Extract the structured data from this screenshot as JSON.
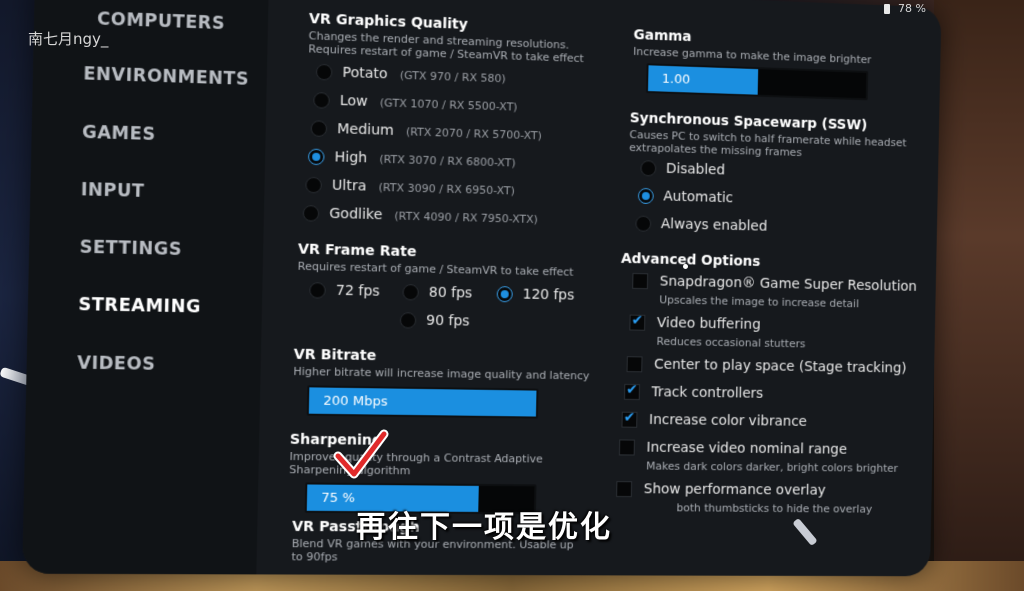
{
  "watermark": "南七月ngy_",
  "battery": "78 %",
  "subtitle": "再往下一项是优化",
  "nav": [
    "COMPUTERS",
    "ENVIRONMENTS",
    "GAMES",
    "INPUT",
    "SETTINGS",
    "STREAMING",
    "VIDEOS"
  ],
  "nav_active": "STREAMING",
  "quality": {
    "title": "VR Graphics Quality",
    "desc1": "Changes the render and streaming resolutions.",
    "desc2": "Requires restart of game / SteamVR to take effect",
    "options": [
      {
        "label": "Potato",
        "hint": "(GTX 970 / RX 580)"
      },
      {
        "label": "Low",
        "hint": "(GTX 1070 / RX 5500-XT)"
      },
      {
        "label": "Medium",
        "hint": "(RTX 2070 / RX 5700-XT)"
      },
      {
        "label": "High",
        "hint": "(RTX 3070 / RX 6800-XT)"
      },
      {
        "label": "Ultra",
        "hint": "(RTX 3090 / RX 6950-XT)"
      },
      {
        "label": "Godlike",
        "hint": "(RTX 4090 / RX 7950-XTX)"
      }
    ],
    "selected": "High"
  },
  "framerate": {
    "title": "VR Frame Rate",
    "desc": "Requires restart of game / SteamVR to take effect",
    "options": [
      "72 fps",
      "80 fps",
      "120 fps",
      "90 fps"
    ],
    "selected": "120 fps"
  },
  "bitrate": {
    "title": "VR Bitrate",
    "desc": "Higher bitrate will increase image quality and latency",
    "value": "200 Mbps",
    "fill": 1.0
  },
  "sharpening": {
    "title": "Sharpening",
    "desc1": "Improves quality through a Contrast Adaptive",
    "desc2": "Sharpening algorithm",
    "value": "75 %",
    "fill": 0.75
  },
  "passthrough": {
    "title": "VR Passthrough",
    "desc1": "Blend VR games with your environment. Usable up",
    "desc2": "to 90fps"
  },
  "gamma": {
    "title": "Gamma",
    "desc": "Increase gamma to make the image brighter",
    "value": "1.00",
    "fill": 0.5
  },
  "ssw": {
    "title": "Synchronous Spacewarp (SSW)",
    "desc1": "Causes PC to switch to half framerate while headset",
    "desc2": "extrapolates the missing frames",
    "options": [
      "Disabled",
      "Automatic",
      "Always enabled"
    ],
    "selected": "Automatic"
  },
  "advanced": {
    "title": "Advanced Options",
    "items": [
      {
        "label": "Snapdragon® Game Super Resolution",
        "desc": "Upscales the image to increase detail",
        "checked": false
      },
      {
        "label": "Video buffering",
        "desc": "Reduces occasional stutters",
        "checked": true
      },
      {
        "label": "Center to play space (Stage tracking)",
        "desc": "",
        "checked": false
      },
      {
        "label": "Track controllers",
        "desc": "",
        "checked": true
      },
      {
        "label": "Increase color vibrance",
        "desc": "",
        "checked": true
      },
      {
        "label": "Increase video nominal range",
        "desc": "Makes dark colors darker, bright colors brighter",
        "checked": false
      },
      {
        "label": "Show performance overlay",
        "desc": "both thumbsticks to hide the overlay",
        "checked": false
      }
    ]
  },
  "colors": {
    "accent": "#1b8fe0",
    "panel": "#16191d",
    "sidebar": "#101316"
  }
}
